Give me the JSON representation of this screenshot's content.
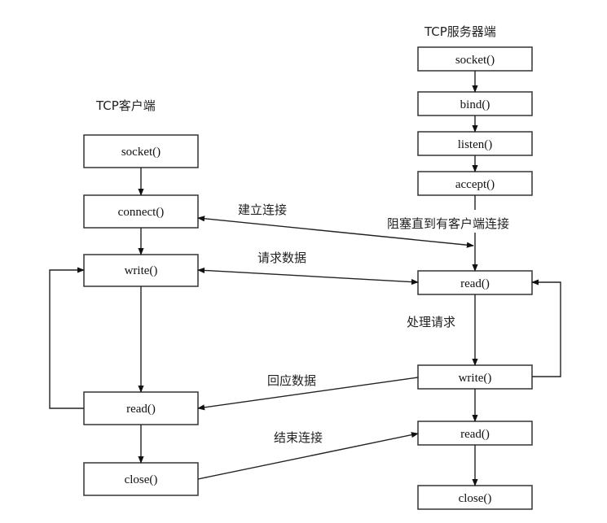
{
  "client": {
    "title": "TCP客户端",
    "boxes": {
      "socket": "socket()",
      "connect": "connect()",
      "write": "write()",
      "read": "read()",
      "close": "close()"
    }
  },
  "server": {
    "title": "TCP服务器端",
    "boxes": {
      "socket": "socket()",
      "bind": "bind()",
      "listen": "listen()",
      "accept": "accept()",
      "read1": "read()",
      "write": "write()",
      "read2": "read()",
      "close": "close()"
    }
  },
  "labels": {
    "establish": "建立连接",
    "blocking": "阻塞直到有客户端连接",
    "request": "请求数据",
    "process": "处理请求",
    "response": "回应数据",
    "finish": "结束连接"
  }
}
